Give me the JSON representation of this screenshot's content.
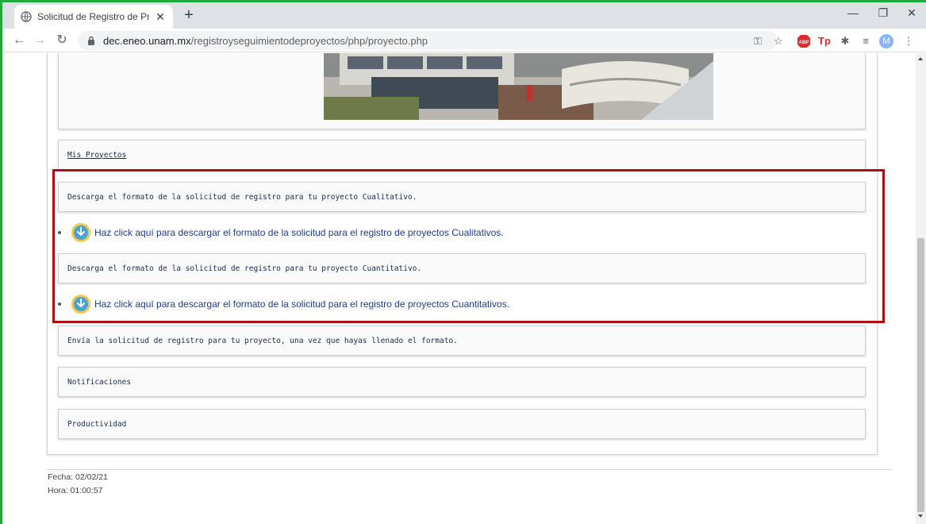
{
  "browser": {
    "tab_title": "Solicitud de Registro de Proyecto",
    "url_host": "dec.eneo.unam.mx",
    "url_path": "/registroyseguimientodeproyectos/php/proyecto.php",
    "profile_initial": "M"
  },
  "page": {
    "mis_proyectos_link": "Mis Proyectos",
    "cualitativo_heading": "Descarga el formato de la solicitud de registro para tu proyecto Cualitativo.",
    "cualitativo_link": "Haz click aquí para descargar el formato de la solicitud para el registro de proyectos Cualitativos.",
    "cuantitativo_heading": "Descarga el formato de la solicitud de registro para tu proyecto Cuantitativo.",
    "cuantitativo_link": "Haz click aquí para descargar el formato de la solicitud para el registro de proyectos Cuantitativos.",
    "envia_text": "Envía la solicitud de registro para tu proyecto, una vez que hayas llenado el formato.",
    "notificaciones": "Notificaciones",
    "productividad": "Productividad"
  },
  "footer": {
    "fecha": "Fecha: 02/02/21",
    "hora": "Hora: 01:00:57"
  },
  "colors": {
    "highlight_border": "#b00d12",
    "window_frame": "#1faa3c",
    "link": "#1f3a93"
  }
}
